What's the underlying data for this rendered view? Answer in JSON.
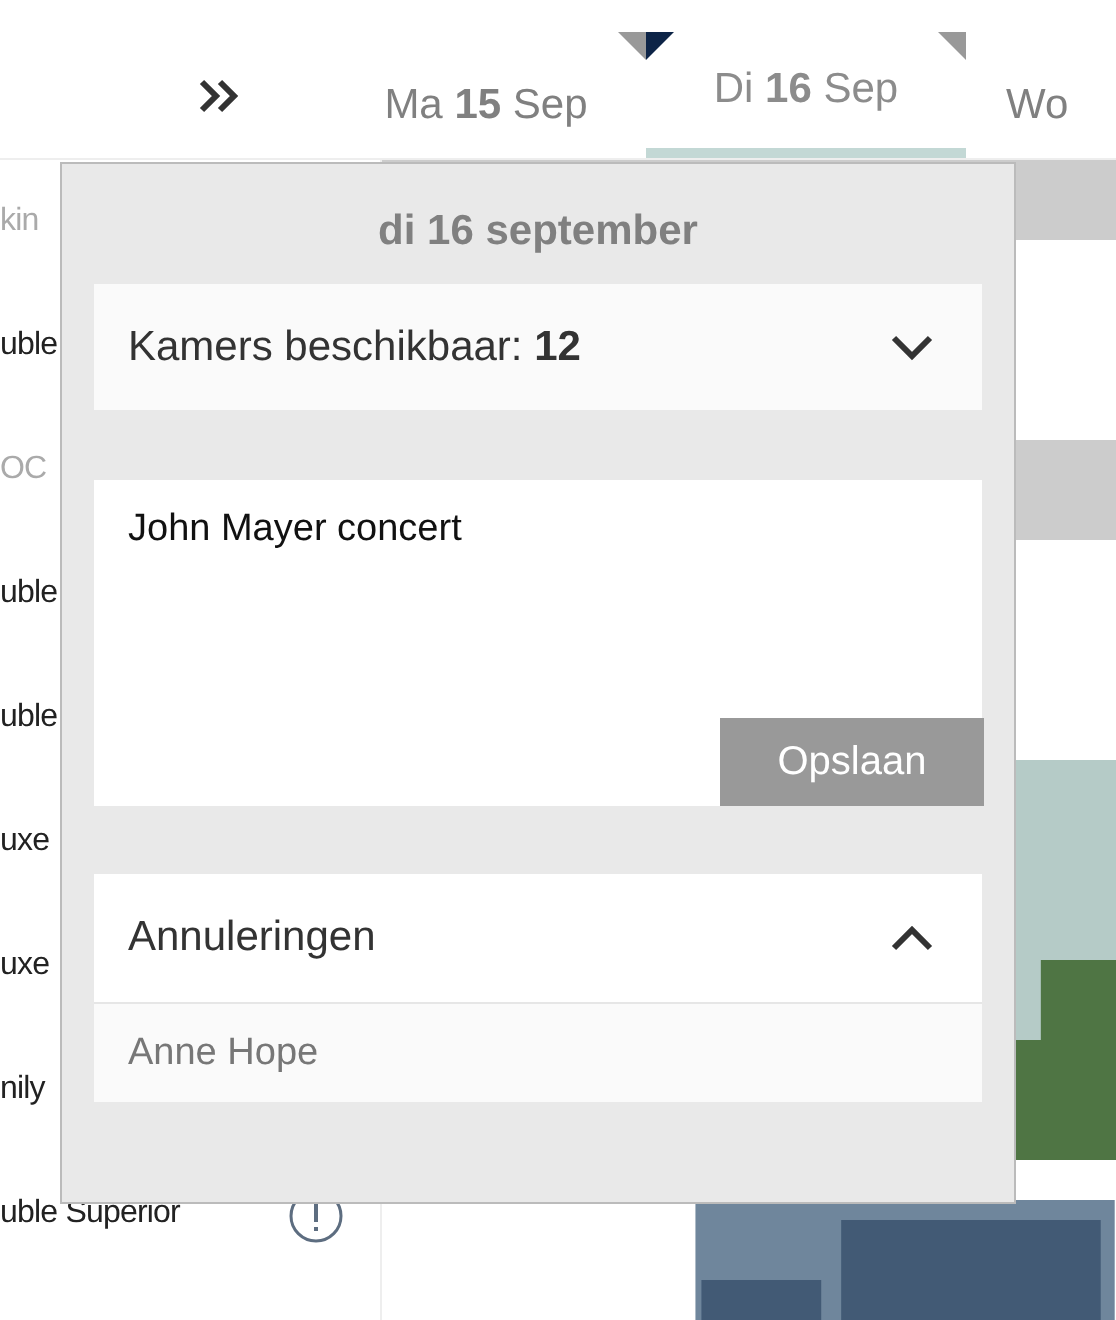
{
  "tabs": [
    {
      "day": "Ma",
      "date": "15",
      "month": "Sep",
      "selected": false,
      "right_flag": {
        "color": "#999999"
      }
    },
    {
      "day": "Di",
      "date": "16",
      "month": "Sep",
      "selected": true,
      "left_flag": {
        "color": "#0d2447"
      },
      "right_flag": {
        "color": "#999999"
      }
    },
    {
      "day": "Wo",
      "selected": false
    }
  ],
  "rooms": [
    {
      "label": "kin",
      "kind": "group"
    },
    {
      "label": "uble",
      "kind": "room"
    },
    {
      "label": "OC",
      "kind": "group"
    },
    {
      "label": "uble",
      "kind": "room"
    },
    {
      "label": "uble",
      "kind": "room"
    },
    {
      "label": "uxe",
      "kind": "room"
    },
    {
      "label": "uxe",
      "kind": "room"
    },
    {
      "label": "nily",
      "kind": "room"
    },
    {
      "label": "uble Superior",
      "kind": "alert_room"
    }
  ],
  "popup": {
    "title": "di 16 september",
    "availability": {
      "label": "Kamers beschikbaar: **12**",
      "expanded": false
    },
    "note": {
      "value": "John Mayer concert",
      "save_button": "Opslaan"
    },
    "cancellations": {
      "label": "Annuleringen",
      "expanded": true,
      "items": [
        "Anne Hope"
      ]
    }
  }
}
